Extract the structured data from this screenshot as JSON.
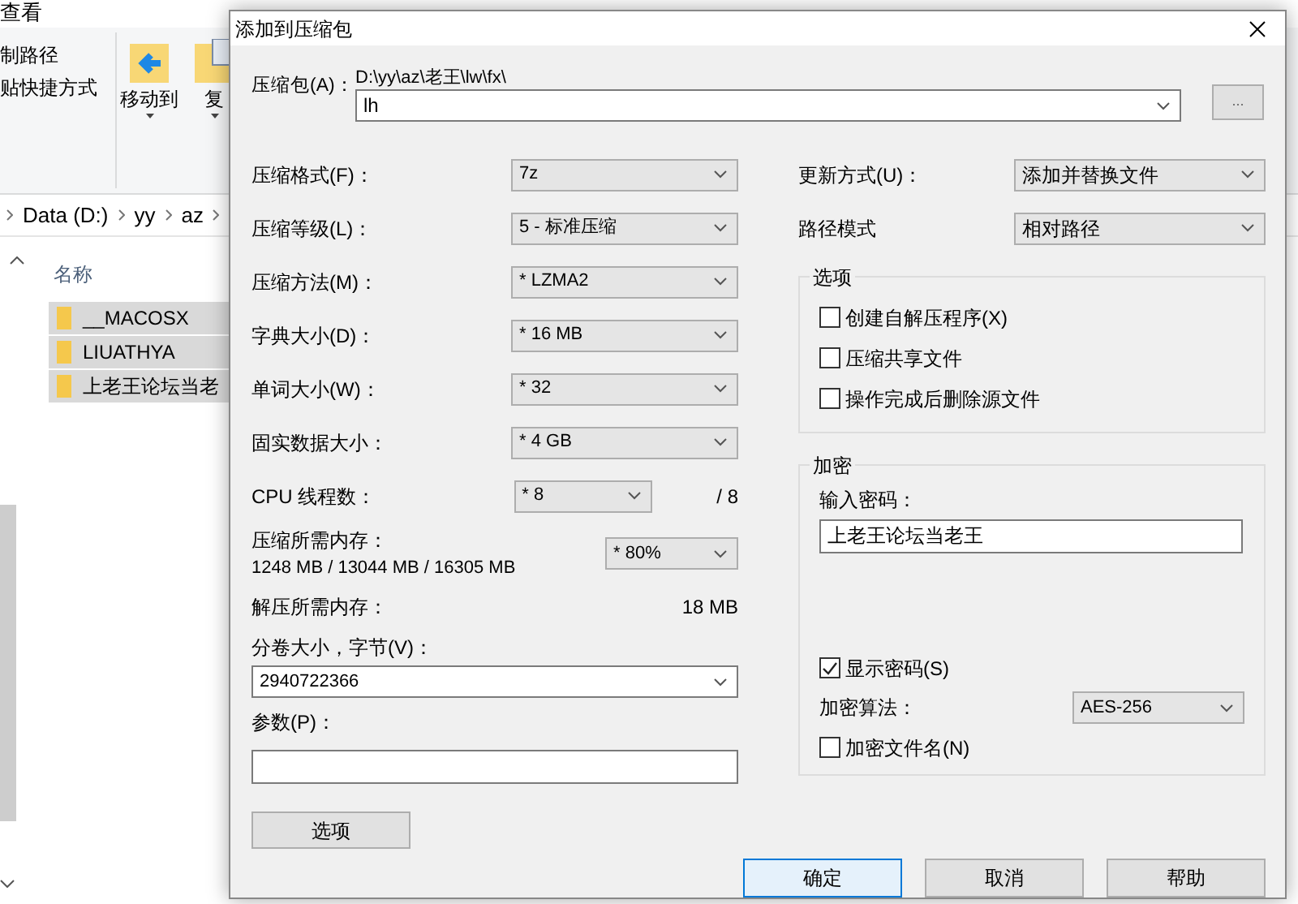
{
  "explorer": {
    "menu": "查看",
    "ribbon_items": [
      {
        "label": "制路径"
      },
      {
        "label": "贴快捷方式"
      }
    ],
    "ribbon_buttons": [
      {
        "label": "移动到",
        "kind": "move"
      },
      {
        "label": "复",
        "kind": "copy"
      }
    ],
    "breadcrumb": [
      "Data (D:)",
      "yy",
      "az"
    ],
    "column": "名称",
    "files": [
      {
        "name": "__MACOSX",
        "selected": true
      },
      {
        "name": "LIUATHYA",
        "selected": true
      },
      {
        "name": "上老王论坛当老",
        "selected": true
      }
    ]
  },
  "dialog": {
    "title": "添加到压缩包",
    "archive": {
      "label": "压缩包(A)：",
      "path": "D:\\yy\\az\\老王\\lw\\fx\\",
      "value": "lh",
      "browse": "..."
    },
    "settings": [
      {
        "label": "压缩格式(F)：",
        "value": "7z"
      },
      {
        "label": "压缩等级(L)：",
        "value": "5 - 标准压缩"
      },
      {
        "label": "压缩方法(M)：",
        "value": "* LZMA2"
      },
      {
        "label": "字典大小(D)：",
        "value": "* 16 MB"
      },
      {
        "label": "单词大小(W)：",
        "value": "* 32"
      },
      {
        "label": "固实数据大小：",
        "value": "* 4 GB"
      }
    ],
    "cpu": {
      "label": "CPU 线程数：",
      "value": "* 8",
      "max": "/ 8"
    },
    "memory": {
      "label": "压缩所需内存：",
      "detail": "1248 MB / 13044 MB / 16305 MB",
      "value": "* 80%"
    },
    "decompress_memory": {
      "label": "解压所需内存：",
      "value": "18 MB"
    },
    "volume": {
      "label": "分卷大小，字节(V)：",
      "value": "2940722366"
    },
    "parameters": {
      "label": "参数(P)："
    },
    "options_button": "选项",
    "update_mode": {
      "label": "更新方式(U)：",
      "value": "添加并替换文件"
    },
    "path_mode": {
      "label": "路径模式",
      "value": "相对路径"
    },
    "options_group": {
      "title": "选项",
      "checkboxes": [
        {
          "label": "创建自解压程序(X)",
          "checked": false
        },
        {
          "label": "压缩共享文件",
          "checked": false
        },
        {
          "label": "操作完成后删除源文件",
          "checked": false
        }
      ]
    },
    "encryption": {
      "title": "加密",
      "password_label": "输入密码：",
      "password": "上老王论坛当老王",
      "show_password": {
        "label": "显示密码(S)",
        "checked": true
      },
      "method": {
        "label": "加密算法：",
        "value": "AES-256"
      },
      "encrypt_names": {
        "label": "加密文件名(N)",
        "checked": false
      }
    },
    "buttons": [
      {
        "label": "确定",
        "default": true
      },
      {
        "label": "取消",
        "default": false
      },
      {
        "label": "帮助",
        "default": false
      }
    ]
  }
}
